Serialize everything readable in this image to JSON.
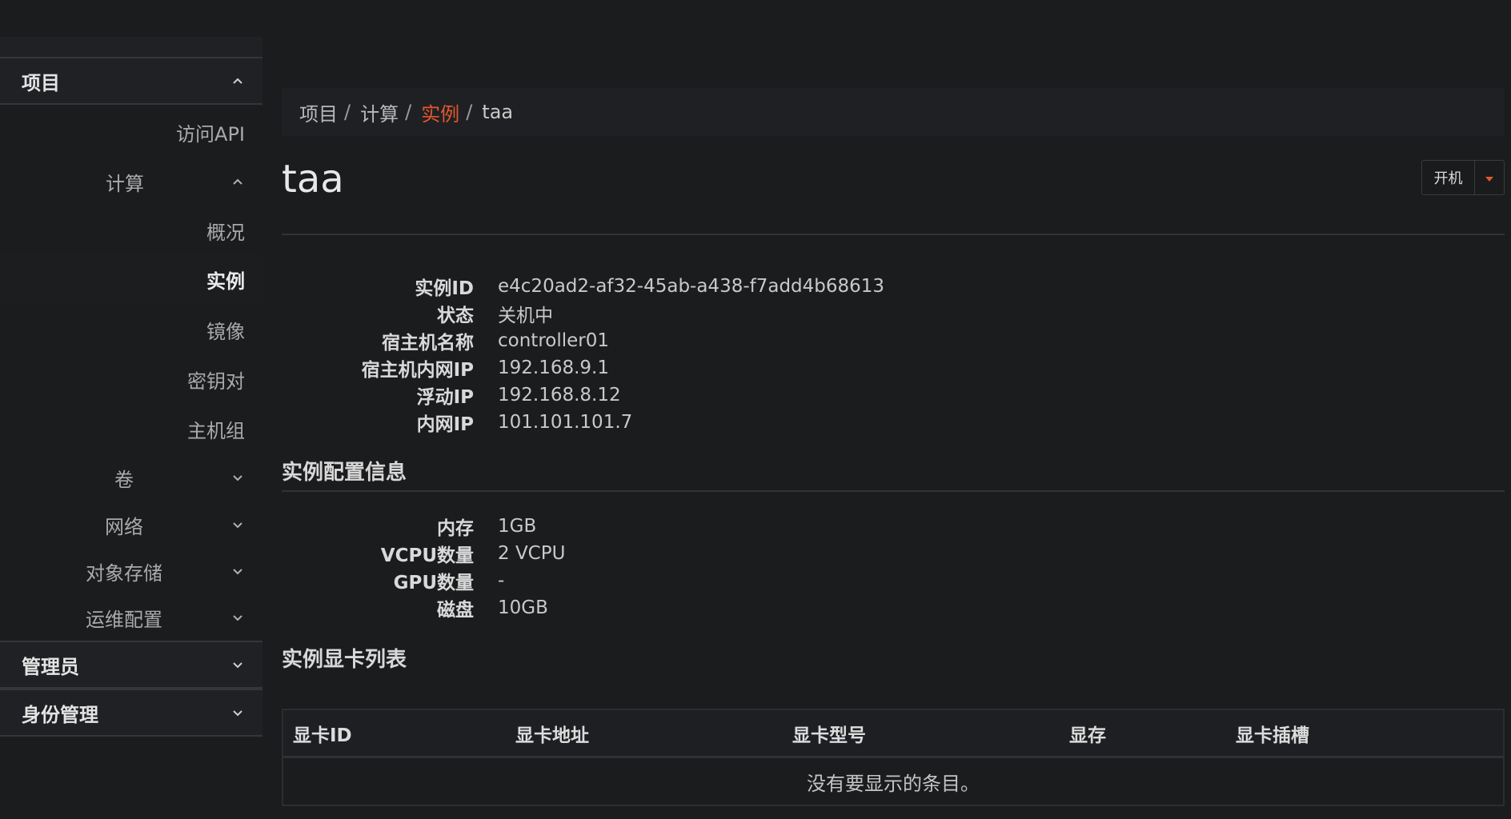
{
  "sidebar": {
    "project": {
      "label": "项目"
    },
    "access_api": {
      "label": "访问API"
    },
    "compute": {
      "label": "计算"
    },
    "compute_items": [
      {
        "label": "概况"
      },
      {
        "label": "实例"
      },
      {
        "label": "镜像"
      },
      {
        "label": "密钥对"
      },
      {
        "label": "主机组"
      }
    ],
    "groups": [
      {
        "label": "卷"
      },
      {
        "label": "网络"
      },
      {
        "label": "对象存储"
      },
      {
        "label": "运维配置"
      }
    ],
    "admin": {
      "label": "管理员"
    },
    "identity": {
      "label": "身份管理"
    }
  },
  "breadcrumb": {
    "items": [
      "项目",
      "计算",
      "实例",
      "taa"
    ],
    "separator": "/"
  },
  "page": {
    "title": "taa",
    "action_button": "开机"
  },
  "overview": [
    {
      "key": "实例ID",
      "value": "e4c20ad2-af32-45ab-a438-f7add4b68613"
    },
    {
      "key": "状态",
      "value": "关机中"
    },
    {
      "key": "宿主机名称",
      "value": "controller01"
    },
    {
      "key": "宿主机内网IP",
      "value": "192.168.9.1"
    },
    {
      "key": "浮动IP",
      "value": "192.168.8.12"
    },
    {
      "key": "内网IP",
      "value": "101.101.101.7"
    }
  ],
  "config_section": {
    "title": "实例配置信息",
    "items": [
      {
        "key": "内存",
        "value": "1GB"
      },
      {
        "key": "VCPU数量",
        "value": "2 VCPU"
      },
      {
        "key": "GPU数量",
        "value": "-"
      },
      {
        "key": "磁盘",
        "value": "10GB"
      }
    ]
  },
  "gpu_section": {
    "title": "实例显卡列表",
    "columns": [
      "显卡ID",
      "显卡地址",
      "显卡型号",
      "显存",
      "显卡插槽"
    ],
    "empty_text": "没有要显示的条目。"
  },
  "colors": {
    "accent": "#e0582c",
    "background": "#1b1c1e"
  }
}
